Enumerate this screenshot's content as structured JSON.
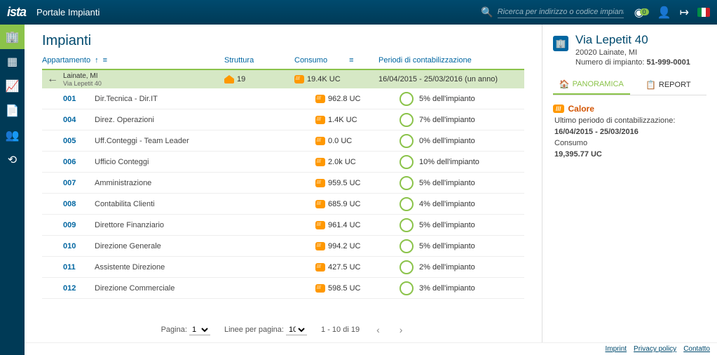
{
  "brand": "ista",
  "portalName": "Portale Impianti",
  "search": {
    "placeholder": "Ricerca per indirizzo o codice impianto"
  },
  "notifCount": "0",
  "sidenav": [
    "building",
    "grid",
    "chart",
    "doc",
    "users",
    "refresh"
  ],
  "pageTitle": "Impianti",
  "columns": {
    "apt": "Appartamento",
    "struct": "Struttura",
    "cons": "Consumo",
    "period": "Periodi di contabilizzazione"
  },
  "headerRow": {
    "city": "Lainate,  MI",
    "addr": "Via Lepetit 40",
    "struct": "19",
    "cons": "19.4K UC",
    "period": "16/04/2015 - 25/03/2016 (un anno)"
  },
  "rows": [
    {
      "num": "001",
      "name": "Dir.Tecnica - Dir.IT",
      "cons": "962.8 UC",
      "period": "5% dell'impianto"
    },
    {
      "num": "004",
      "name": "Direz. Operazioni",
      "cons": "1.4K UC",
      "period": "7% dell'impianto"
    },
    {
      "num": "005",
      "name": "Uff.Conteggi - Team Leader",
      "cons": "0.0 UC",
      "period": "0% dell'impianto"
    },
    {
      "num": "006",
      "name": "Ufficio Conteggi",
      "cons": "2.0k UC",
      "period": "10% dell'impianto"
    },
    {
      "num": "007",
      "name": "Amministrazione",
      "cons": "959.5 UC",
      "period": "5% dell'impianto"
    },
    {
      "num": "008",
      "name": "Contabilita Clienti",
      "cons": "685.9 UC",
      "period": "4% dell'impianto"
    },
    {
      "num": "009",
      "name": "Direttore Finanziario",
      "cons": "961.4 UC",
      "period": "5% dell'impianto"
    },
    {
      "num": "010",
      "name": "Direzione Generale",
      "cons": "994.2 UC",
      "period": "5% dell'impianto"
    },
    {
      "num": "011",
      "name": "Assistente Direzione",
      "cons": "427.5 UC",
      "period": "2% dell'impianto"
    },
    {
      "num": "012",
      "name": "Direzione Commerciale",
      "cons": "598.5 UC",
      "period": "3% dell'impianto"
    }
  ],
  "pager": {
    "pageLabel": "Pagina:",
    "pageValue": "1",
    "perPageLabel": "Linee per pagina:",
    "perPageValue": "10",
    "range": "1 - 10 di 19"
  },
  "detail": {
    "title": "Via Lepetit 40",
    "sub": "20020 Lainate, MI",
    "numLabel": "Numero di impianto:",
    "numValue": "51-999-0001",
    "tabs": {
      "panoramica": "PANORAMICA",
      "report": "REPORT"
    },
    "sectionBadge": "///",
    "sectionName": "Calore",
    "lastPeriodLabel": "Ultimo periodo di contabilizzazione:",
    "lastPeriodValue": "16/04/2015 - 25/03/2016",
    "consLabel": "Consumo",
    "consValue": "19,395.77 UC"
  },
  "footer": {
    "imprint": "Imprint",
    "privacy": "Privacy policy",
    "contact": "Contatto"
  }
}
